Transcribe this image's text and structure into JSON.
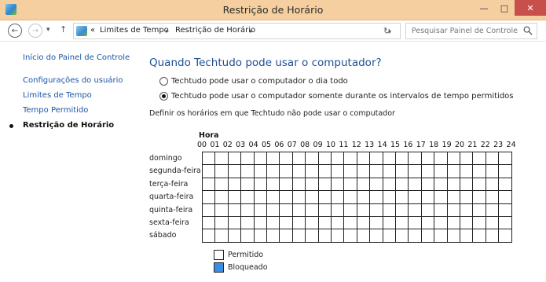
{
  "window": {
    "title": "Restrição de Horário",
    "controls": {
      "minimize": "—",
      "maximize": "□",
      "close": "✕"
    }
  },
  "address": {
    "back_icon": "back-arrow-icon",
    "forward_icon": "forward-arrow-icon",
    "overflow": "«",
    "crumbs": [
      "Limites de Tempo",
      "Restrição de Horário"
    ],
    "separator": "▸",
    "dropdown": "▾",
    "refresh": "↻",
    "search_placeholder": "Pesquisar Painel de Controle"
  },
  "sidebar": {
    "items": [
      {
        "label": "Início do Painel de Controle",
        "active": false
      },
      {
        "label": "Configurações do usuário",
        "active": false
      },
      {
        "label": "Limites de Tempo",
        "active": false
      },
      {
        "label": "Tempo Permitido",
        "active": false
      },
      {
        "label": "Restrição de Horário",
        "active": true
      }
    ]
  },
  "main": {
    "title": "Quando Techtudo pode usar o computador?",
    "options": [
      {
        "label": "Techtudo pode usar o computador o dia todo",
        "checked": false
      },
      {
        "label": "Techtudo pode usar o computador somente durante os intervalos de tempo permitidos",
        "checked": true
      }
    ],
    "instruction": "Definir os horários em que Techtudo não pode usar o computador",
    "grid": {
      "hour_heading": "Hora",
      "hours": [
        "00",
        "01",
        "02",
        "03",
        "04",
        "05",
        "06",
        "07",
        "08",
        "09",
        "10",
        "11",
        "12",
        "13",
        "14",
        "15",
        "16",
        "17",
        "18",
        "19",
        "20",
        "21",
        "22",
        "23",
        "24"
      ],
      "days": [
        "domingo",
        "segunda-feira",
        "terça-feira",
        "quarta-feira",
        "quinta-feira",
        "sexta-feira",
        "sábado"
      ],
      "blocked_count": 0
    },
    "legend": [
      {
        "label": "Permitido",
        "color": "#ffffff"
      },
      {
        "label": "Bloqueado",
        "color": "#3b8fe0"
      }
    ]
  }
}
